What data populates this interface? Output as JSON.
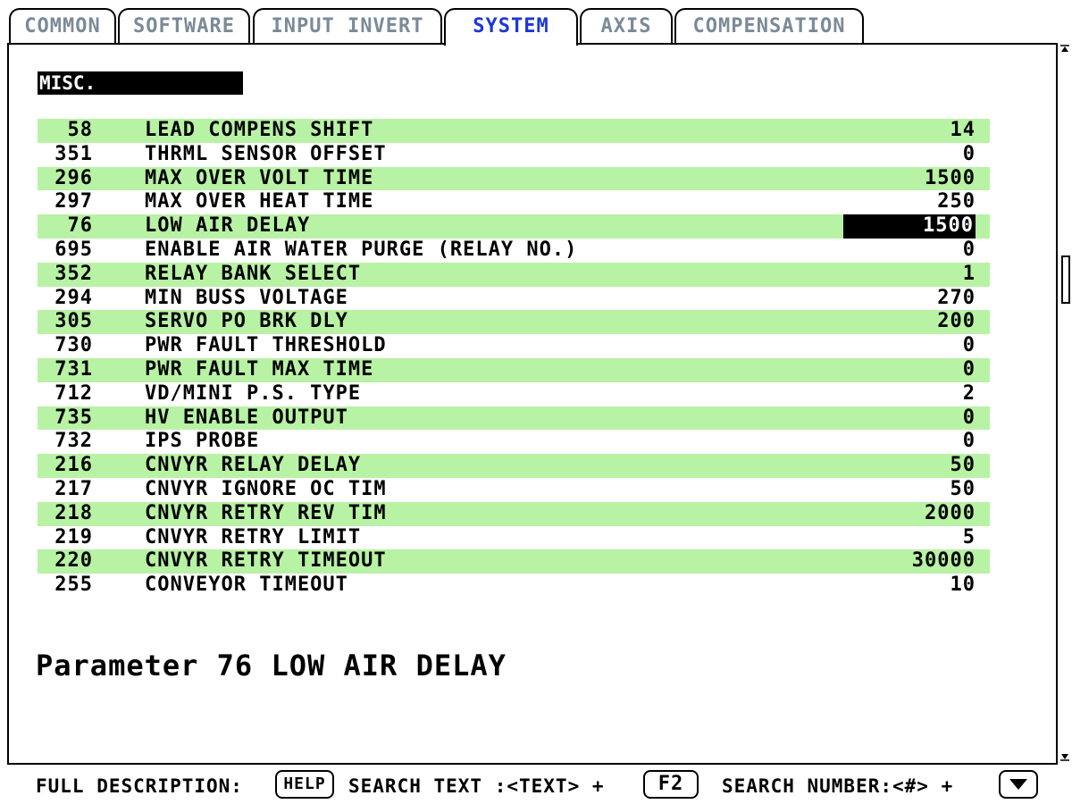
{
  "tabs": [
    {
      "label": "COMMON",
      "active": false
    },
    {
      "label": "SOFTWARE",
      "active": false
    },
    {
      "label": "INPUT INVERT",
      "active": false
    },
    {
      "label": "SYSTEM",
      "active": true
    },
    {
      "label": "AXIS",
      "active": false
    },
    {
      "label": "COMPENSATION",
      "active": false
    }
  ],
  "section": {
    "title": "MISC."
  },
  "parameters": [
    {
      "number": "58",
      "name": "LEAD COMPENS SHIFT",
      "value": "14",
      "shaded": true,
      "selected": false
    },
    {
      "number": "351",
      "name": "THRML SENSOR OFFSET",
      "value": "0",
      "shaded": false,
      "selected": false
    },
    {
      "number": "296",
      "name": "MAX OVER VOLT TIME",
      "value": "1500",
      "shaded": true,
      "selected": false
    },
    {
      "number": "297",
      "name": "MAX OVER HEAT TIME",
      "value": "250",
      "shaded": false,
      "selected": false
    },
    {
      "number": "76",
      "name": "LOW AIR DELAY",
      "value": "1500",
      "shaded": true,
      "selected": true
    },
    {
      "number": "695",
      "name": "ENABLE AIR WATER PURGE (RELAY NO.)",
      "value": "0",
      "shaded": false,
      "selected": false
    },
    {
      "number": "352",
      "name": "RELAY BANK SELECT",
      "value": "1",
      "shaded": true,
      "selected": false
    },
    {
      "number": "294",
      "name": "MIN BUSS VOLTAGE",
      "value": "270",
      "shaded": false,
      "selected": false
    },
    {
      "number": "305",
      "name": "SERVO PO BRK DLY",
      "value": "200",
      "shaded": true,
      "selected": false
    },
    {
      "number": "730",
      "name": "PWR FAULT THRESHOLD",
      "value": "0",
      "shaded": false,
      "selected": false
    },
    {
      "number": "731",
      "name": "PWR FAULT MAX TIME",
      "value": "0",
      "shaded": true,
      "selected": false
    },
    {
      "number": "712",
      "name": "VD/MINI P.S. TYPE",
      "value": "2",
      "shaded": false,
      "selected": false
    },
    {
      "number": "735",
      "name": "HV ENABLE OUTPUT",
      "value": "0",
      "shaded": true,
      "selected": false
    },
    {
      "number": "732",
      "name": "IPS PROBE",
      "value": "0",
      "shaded": false,
      "selected": false
    },
    {
      "number": "216",
      "name": "CNVYR RELAY DELAY",
      "value": "50",
      "shaded": true,
      "selected": false
    },
    {
      "number": "217",
      "name": "CNVYR IGNORE OC TIM",
      "value": "50",
      "shaded": false,
      "selected": false
    },
    {
      "number": "218",
      "name": "CNVYR RETRY REV TIM",
      "value": "2000",
      "shaded": true,
      "selected": false
    },
    {
      "number": "219",
      "name": "CNVYR RETRY LIMIT",
      "value": "5",
      "shaded": false,
      "selected": false
    },
    {
      "number": "220",
      "name": "CNVYR RETRY TIMEOUT",
      "value": "30000",
      "shaded": true,
      "selected": false
    },
    {
      "number": "255",
      "name": "CONVEYOR TIMEOUT",
      "value": "10",
      "shaded": false,
      "selected": false
    }
  ],
  "description": {
    "text": "Parameter 76 LOW AIR DELAY"
  },
  "footer": {
    "full_description_label": "FULL DESCRIPTION:",
    "help_key": "HELP",
    "search_text_label": "SEARCH TEXT :<TEXT> +",
    "f2_key": "F2",
    "search_number_label": "SEARCH NUMBER:<#> +",
    "down_key_icon": "down-arrow-icon"
  },
  "colors": {
    "active_tab": "#1a37d8",
    "inactive_tab": "#7b8a98",
    "row_highlight": "#b8f2a4",
    "selection": "#000000"
  }
}
